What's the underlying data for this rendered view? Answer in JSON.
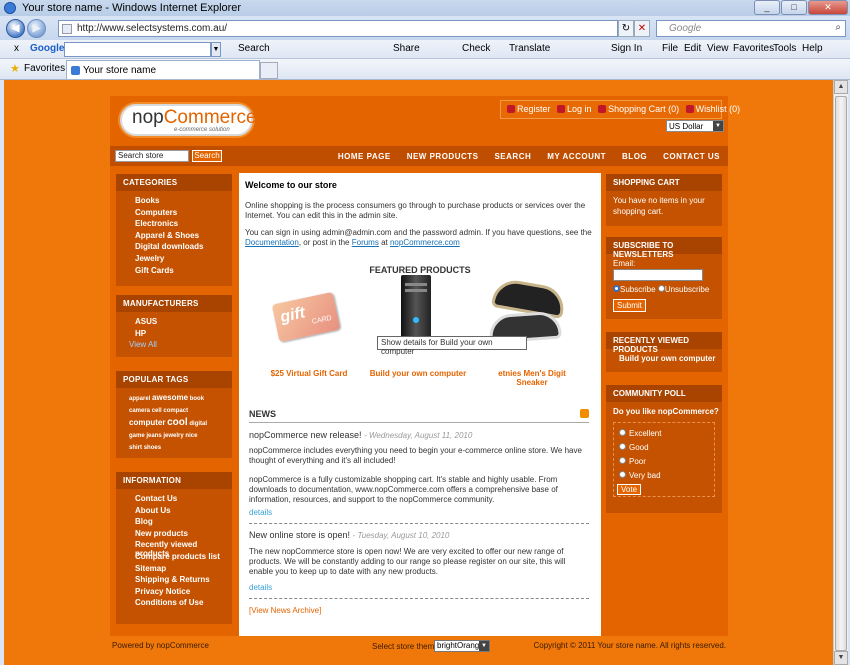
{
  "browser": {
    "title": "Your store name - Windows Internet Explorer",
    "url": "http://www.selectsystems.com.au/",
    "search_placeholder": "Google",
    "toolbar": {
      "close": "x",
      "google": "Google",
      "search": "Search",
      "share": "Share",
      "check": "Check",
      "translate": "Translate",
      "signin": "Sign In",
      "menus": [
        "File",
        "Edit",
        "View",
        "Favorites",
        "Tools",
        "Help"
      ]
    },
    "favorites": "Favorites",
    "tab_title": "Your store name"
  },
  "site": {
    "logo_main": "nop",
    "logo_accent": "Commerce",
    "logo_tag": "e-commerce solution",
    "toplinks": {
      "register": "Register",
      "login": "Log in",
      "cart": "Shopping Cart (0)",
      "wishlist": "Wishlist (0)"
    },
    "currency": "US Dollar",
    "search_value": "Search store",
    "search_button": "Search",
    "menu": [
      "HOME PAGE",
      "NEW PRODUCTS",
      "SEARCH",
      "MY ACCOUNT",
      "BLOG",
      "CONTACT US"
    ],
    "categories": {
      "title": "CATEGORIES",
      "items": [
        "Books",
        "Computers",
        "Electronics",
        "Apparel & Shoes",
        "Digital downloads",
        "Jewelry",
        "Gift Cards"
      ]
    },
    "manufacturers": {
      "title": "MANUFACTURERS",
      "items": [
        "ASUS",
        "HP"
      ],
      "view_all": "View All"
    },
    "tags": {
      "title": "POPULAR TAGS",
      "items": [
        "apparel",
        "awesome",
        "book",
        "camera",
        "cell",
        "compact",
        "computer",
        "cool",
        "digital",
        "game",
        "jeans",
        "jewelry",
        "nice",
        "shirt",
        "shoes"
      ]
    },
    "information": {
      "title": "INFORMATION",
      "items": [
        "Contact Us",
        "About Us",
        "Blog",
        "New products",
        "Recently viewed products",
        "Compare products list",
        "Sitemap",
        "Shipping & Returns",
        "Privacy Notice",
        "Conditions of Use"
      ]
    },
    "welcome": {
      "title": "Welcome to our store",
      "p1": "Online shopping is the process consumers go through to purchase products or services over the Internet. You can edit this in the admin site.",
      "p2a": "You can sign in using admin@admin.com and the password admin. If you have questions, see the ",
      "doc_link": "Documentation",
      "p2b": ", or post in the ",
      "forums_link": "Forums",
      "p2c": " at ",
      "site_link": "nopCommerce.com"
    },
    "featured": {
      "title": "FEATURED PRODUCTS",
      "products": [
        "$25 Virtual Gift Card",
        "Build your own computer",
        "etnies Men's Digit Sneaker"
      ],
      "gift_text": "gift",
      "gift_card": "CARD",
      "tooltip": "Show details for Build your own computer"
    },
    "news": {
      "title": "NEWS",
      "items": [
        {
          "title": "nopCommerce new release!",
          "date": "- Wednesday, August 11, 2010",
          "text1": "nopCommerce includes everything you need to begin your e-commerce online store. We have thought of everything and it's all included!",
          "text2": "nopCommerce is a fully customizable shopping cart. It's stable and highly usable. From downloads to documentation, www.nopCommerce.com offers a comprehensive base of information, resources, and support to the nopCommerce community.",
          "details": "details"
        },
        {
          "title": "New online store is open!",
          "date": "- Tuesday, August 10, 2010",
          "text1": "The new nopCommerce store is open now! We are very excited to offer our new range of products. We will be constantly adding to our range so please register on our site, this will enable you to keep up to date with any new products.",
          "details": "details"
        }
      ],
      "archive": "[View News Archive]"
    },
    "cart": {
      "title": "SHOPPING CART",
      "text": "You have no items in your shopping cart."
    },
    "newsletter": {
      "title": "SUBSCRIBE TO NEWSLETTERS",
      "email_label": "Email:",
      "subscribe": "Subscribe",
      "unsubscribe": "Unsubscribe",
      "submit": "Submit"
    },
    "recent": {
      "title": "RECENTLY VIEWED PRODUCTS",
      "item": "Build your own computer"
    },
    "poll": {
      "title": "COMMUNITY POLL",
      "question": "Do you like nopCommerce?",
      "options": [
        "Excellent",
        "Good",
        "Poor",
        "Very bad"
      ],
      "vote": "Vote"
    },
    "footer": {
      "powered": "Powered by ",
      "powered_link": "nopCommerce",
      "theme_label": "Select store theme:",
      "theme": "brightOrange",
      "copyright": "Copyright © 2011 Your store name. All rights reserved."
    }
  }
}
